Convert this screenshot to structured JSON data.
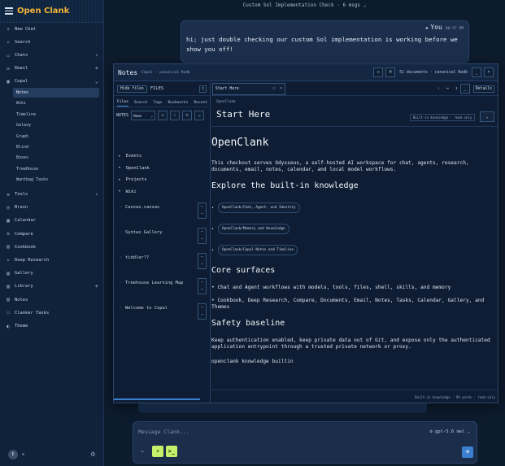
{
  "app": {
    "brand": "Open Clank"
  },
  "sidebar": {
    "items": [
      {
        "label": "New Chat",
        "icon": "+",
        "right": ""
      },
      {
        "label": "Search",
        "icon": "⌕",
        "right": ""
      },
      {
        "label": "Chats",
        "icon": "▭",
        "right": "›"
      },
      {
        "label": "Email",
        "icon": "✉",
        "right": "+"
      },
      {
        "label": "Copal",
        "icon": "▣",
        "right": "⌄"
      }
    ],
    "copal_children": [
      "Notes",
      "Wiki",
      "Timeline",
      "Galaxy",
      "Graph",
      "Blind",
      "Boxes",
      "TreeHouse",
      "Wantbag Tasks"
    ],
    "items2": [
      {
        "label": "Tools",
        "icon": "⚒",
        "right": "›"
      },
      {
        "label": "Brain",
        "icon": "◎",
        "right": ""
      },
      {
        "label": "Calendar",
        "icon": "▦",
        "right": ""
      },
      {
        "label": "Compare",
        "icon": "⇆",
        "right": ""
      },
      {
        "label": "Cookbook",
        "icon": "▤",
        "right": ""
      },
      {
        "label": "Deep Research",
        "icon": "⌕",
        "right": ""
      },
      {
        "label": "Gallery",
        "icon": "▧",
        "right": ""
      },
      {
        "label": "Library",
        "icon": "▥",
        "right": "+"
      },
      {
        "label": "Notes",
        "icon": "▤",
        "right": ""
      },
      {
        "label": "Clanker Tasks",
        "icon": "☐",
        "right": ""
      },
      {
        "label": "Theme",
        "icon": "◐",
        "right": ""
      }
    ],
    "avatar": "E",
    "avatar_tag": "e"
  },
  "conversation": {
    "title": "Custom Sol Implementation Check · 6 msgs ⌄"
  },
  "message": {
    "author": "You",
    "time": "06:57 PM",
    "text": "hi; just double checking our custom Sol implementation is working before we show you off!"
  },
  "notes": {
    "title": "Notes",
    "subtitle": "Copal · canonical Redb",
    "doc_count": "51 documents · canonical Redb",
    "hide_files": "Hide files",
    "files_label": "FILES",
    "tabs": [
      "Files",
      "Search",
      "Tags",
      "Bookmarks",
      "Recent"
    ],
    "notes_label": "NOTES",
    "sort": "Name",
    "folders": [
      "Events",
      "OpenClank",
      "Projects",
      "Wiki"
    ],
    "files": [
      "Canvas.canvas",
      "Syntax Gallery",
      "tiddler??",
      "Treehouse Learning Map",
      "Welcome to Copal"
    ],
    "doc_tab": "Start Here",
    "details": "Details",
    "path": "OpenClank",
    "doc_title": "Start Here",
    "kb_badge": "Built-in knowledge · read only",
    "content": {
      "h1": "OpenClank",
      "intro": "This checkout serves Odysseus, a self-hosted AI workspace for chat, agents, research, documents, email, notes, calendar, and local model workflows.",
      "h2_explore": "Explore the built-in knowledge",
      "links": [
        "OpenClank/Chat, Agent, and Identity",
        "OpenClank/Memory and Knowledge",
        "OpenClank/Copal Notes and Timeline"
      ],
      "h2_core": "Core surfaces",
      "core_1": "Chat and Agent workflows with models, tools, files, shell, skills, and memory",
      "core_2": "Cookbook, Deep Research, Compare, Documents, Email, Notes, Tasks, Calendar, Gallery, and Themes",
      "h2_safety": "Safety baseline",
      "safety": "Keep authentication enabled, keep private data out of Git, and expose only the authenticated application entrypoint through a trusted private network or proxy.",
      "tagline": "openclank knowledge builtin"
    },
    "footer": "Built-in knowledge · 99 words · read only"
  },
  "composer": {
    "placeholder": "Message Clank...",
    "model": "gpt-5.6 mel ⌄"
  },
  "colors": {
    "brand": "#f2b43a",
    "accent": "#3b7fd1",
    "lime": "#c3f26a",
    "bg": "#0d1b2e"
  }
}
